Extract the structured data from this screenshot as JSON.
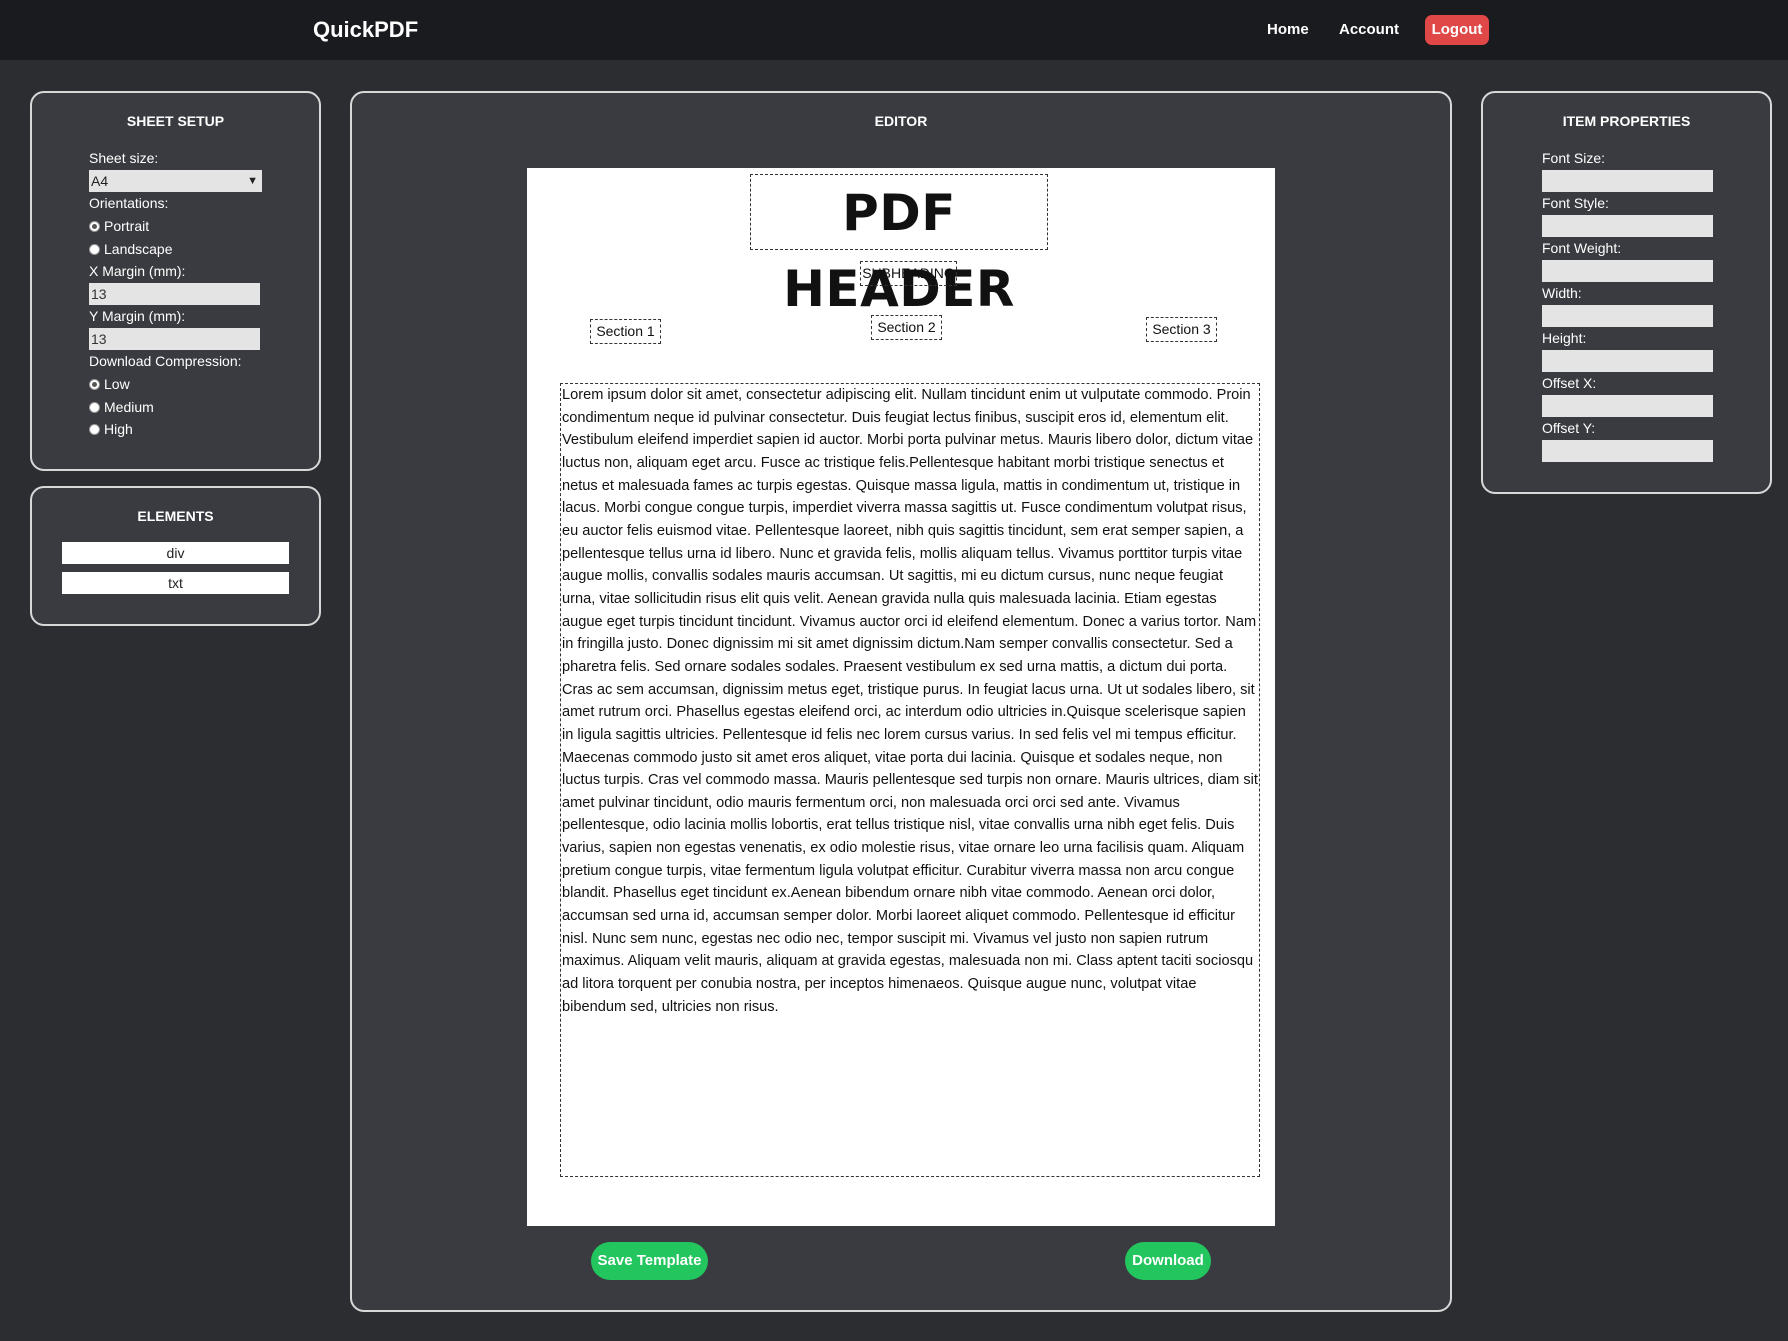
{
  "app": {
    "brand": "QuickPDF",
    "nav": {
      "home": "Home",
      "account": "Account",
      "logout": "Logout"
    }
  },
  "sheet_setup": {
    "title": "SHEET SETUP",
    "sheet_size_label": "Sheet size:",
    "sheet_size_value": "A4",
    "orientations_label": "Orientations:",
    "orientation_options": [
      "Portrait",
      "Landscape"
    ],
    "x_margin_label": "X Margin (mm):",
    "x_margin_value": "13",
    "y_margin_label": "Y Margin (mm):",
    "y_margin_value": "13",
    "compression_label": "Download Compression:",
    "compression_options": [
      "Low",
      "Medium",
      "High"
    ]
  },
  "elements": {
    "title": "ELEMENTS",
    "items": [
      "div",
      "txt"
    ]
  },
  "editor": {
    "title": "EDITOR",
    "header": "PDF HEADER",
    "subheading": "SUBHEADING",
    "sections": [
      "Section 1",
      "Section 2",
      "Section 3"
    ],
    "body": "Lorem ipsum dolor sit amet, consectetur adipiscing elit. Nullam tincidunt enim ut vulputate commodo. Proin condimentum neque id pulvinar consectetur. Duis feugiat lectus finibus, suscipit eros id, elementum elit. Vestibulum eleifend imperdiet sapien id auctor. Morbi porta pulvinar metus. Mauris libero dolor, dictum vitae luctus non, aliquam eget arcu. Fusce ac tristique felis.Pellentesque habitant morbi tristique senectus et netus et malesuada fames ac turpis egestas. Quisque massa ligula, mattis in condimentum ut, tristique in lacus. Morbi congue congue turpis, imperdiet viverra massa sagittis ut. Fusce condimentum volutpat risus, eu auctor felis euismod vitae. Pellentesque laoreet, nibh quis sagittis tincidunt, sem erat semper sapien, a pellentesque tellus urna id libero. Nunc et gravida felis, mollis aliquam tellus. Vivamus porttitor turpis vitae augue mollis, convallis sodales mauris accumsan. Ut sagittis, mi eu dictum cursus, nunc neque feugiat urna, vitae sollicitudin risus elit quis velit. Aenean gravida nulla quis malesuada lacinia. Etiam egestas augue eget turpis tincidunt tincidunt. Vivamus auctor orci id eleifend elementum. Donec a varius tortor. Nam in fringilla justo. Donec dignissim mi sit amet dignissim dictum.Nam semper convallis consectetur. Sed a pharetra felis. Sed ornare sodales sodales. Praesent vestibulum ex sed urna mattis, a dictum dui porta. Cras ac sem accumsan, dignissim metus eget, tristique purus. In feugiat lacus urna. Ut ut sodales libero, sit amet rutrum orci. Phasellus egestas eleifend orci, ac interdum odio ultricies in.Quisque scelerisque sapien in ligula sagittis ultricies. Pellentesque id felis nec lorem cursus varius. In sed felis vel mi tempus efficitur. Maecenas commodo justo sit amet eros aliquet, vitae porta dui lacinia. Quisque et sodales neque, non luctus turpis. Cras vel commodo massa. Mauris pellentesque sed turpis non ornare. Mauris ultrices, diam sit amet pulvinar tincidunt, odio mauris fermentum orci, non malesuada orci orci sed ante. Vivamus pellentesque, odio lacinia mollis lobortis, erat tellus tristique nisl, vitae convallis urna nibh eget felis. Duis varius, sapien non egestas venenatis, ex odio molestie risus, vitae ornare leo urna facilisis quam. Aliquam pretium congue turpis, vitae fermentum ligula volutpat efficitur. Curabitur viverra massa non arcu congue blandit. Phasellus eget tincidunt ex.Aenean bibendum ornare nibh vitae commodo. Aenean orci dolor, accumsan sed urna id, accumsan semper dolor. Morbi laoreet aliquet commodo. Pellentesque id efficitur nisl. Nunc sem nunc, egestas nec odio nec, tempor suscipit mi. Vivamus vel justo non sapien rutrum maximus. Aliquam velit mauris, aliquam at gravida egestas, malesuada non mi. Class aptent taciti sociosqu ad litora torquent per conubia nostra, per inceptos himenaeos. Quisque augue nunc, volutpat vitae bibendum sed, ultricies non risus.",
    "save_label": "Save Template",
    "download_label": "Download"
  },
  "item_properties": {
    "title": "ITEM PROPERTIES",
    "fields": [
      "Font Size:",
      "Font Style:",
      "Font Weight:",
      "Width:",
      "Height:",
      "Offset X:",
      "Offset Y:"
    ]
  },
  "colors": {
    "background": "#2c2d31",
    "topbar": "#1a1b1e",
    "panel": "#3a3b40",
    "logout": "#e04848",
    "action": "#22c55e"
  }
}
